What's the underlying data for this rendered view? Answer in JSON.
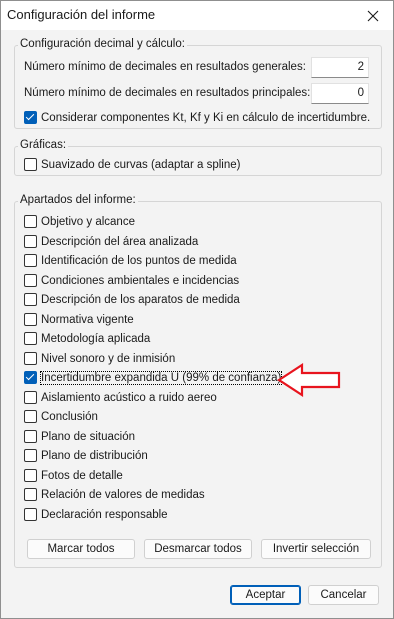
{
  "window": {
    "title": "Configuración del informe"
  },
  "decimal_group": {
    "legend": "Configuración decimal y cálculo:",
    "general_label": "Número mínimo de decimales en resultados generales:",
    "general_value": "2",
    "main_label": "Número mínimo de decimales en resultados principales:",
    "main_value": "0",
    "uncertainty_label": "Considerar componentes Kt, Kf y Ki en cálculo de incertidumbre.",
    "uncertainty_checked": true
  },
  "charts_group": {
    "legend": "Gráficas:",
    "smoothing_label": "Suavizado de curvas (adaptar a spline)",
    "smoothing_checked": false
  },
  "sections_group": {
    "legend": "Apartados del informe:",
    "items": [
      {
        "label": "Objetivo y alcance",
        "checked": false
      },
      {
        "label": "Descripción del área analizada",
        "checked": false
      },
      {
        "label": "Identificación de los puntos de medida",
        "checked": false
      },
      {
        "label": "Condiciones ambientales e incidencias",
        "checked": false
      },
      {
        "label": "Descripción de los aparatos de medida",
        "checked": false
      },
      {
        "label": "Normativa vigente",
        "checked": false
      },
      {
        "label": "Metodología aplicada",
        "checked": false
      },
      {
        "label": "Nivel sonoro y de inmisión",
        "checked": false
      },
      {
        "label": "Incertidumbre expandida U (99% de confianza)",
        "checked": true
      },
      {
        "label": "Aislamiento acústico a ruido aereo",
        "checked": false
      },
      {
        "label": "Conclusión",
        "checked": false
      },
      {
        "label": "Plano de situación",
        "checked": false
      },
      {
        "label": "Plano de distribución",
        "checked": false
      },
      {
        "label": "Fotos de detalle",
        "checked": false
      },
      {
        "label": "Relación de valores de medidas",
        "checked": false
      },
      {
        "label": "Declaración responsable",
        "checked": false
      }
    ],
    "select_all": "Marcar todos",
    "deselect_all": "Desmarcar todos",
    "invert": "Invertir selección"
  },
  "footer": {
    "accept": "Aceptar",
    "cancel": "Cancelar"
  },
  "colors": {
    "accent": "#005fb8",
    "annotation_arrow": "#e8141e"
  }
}
